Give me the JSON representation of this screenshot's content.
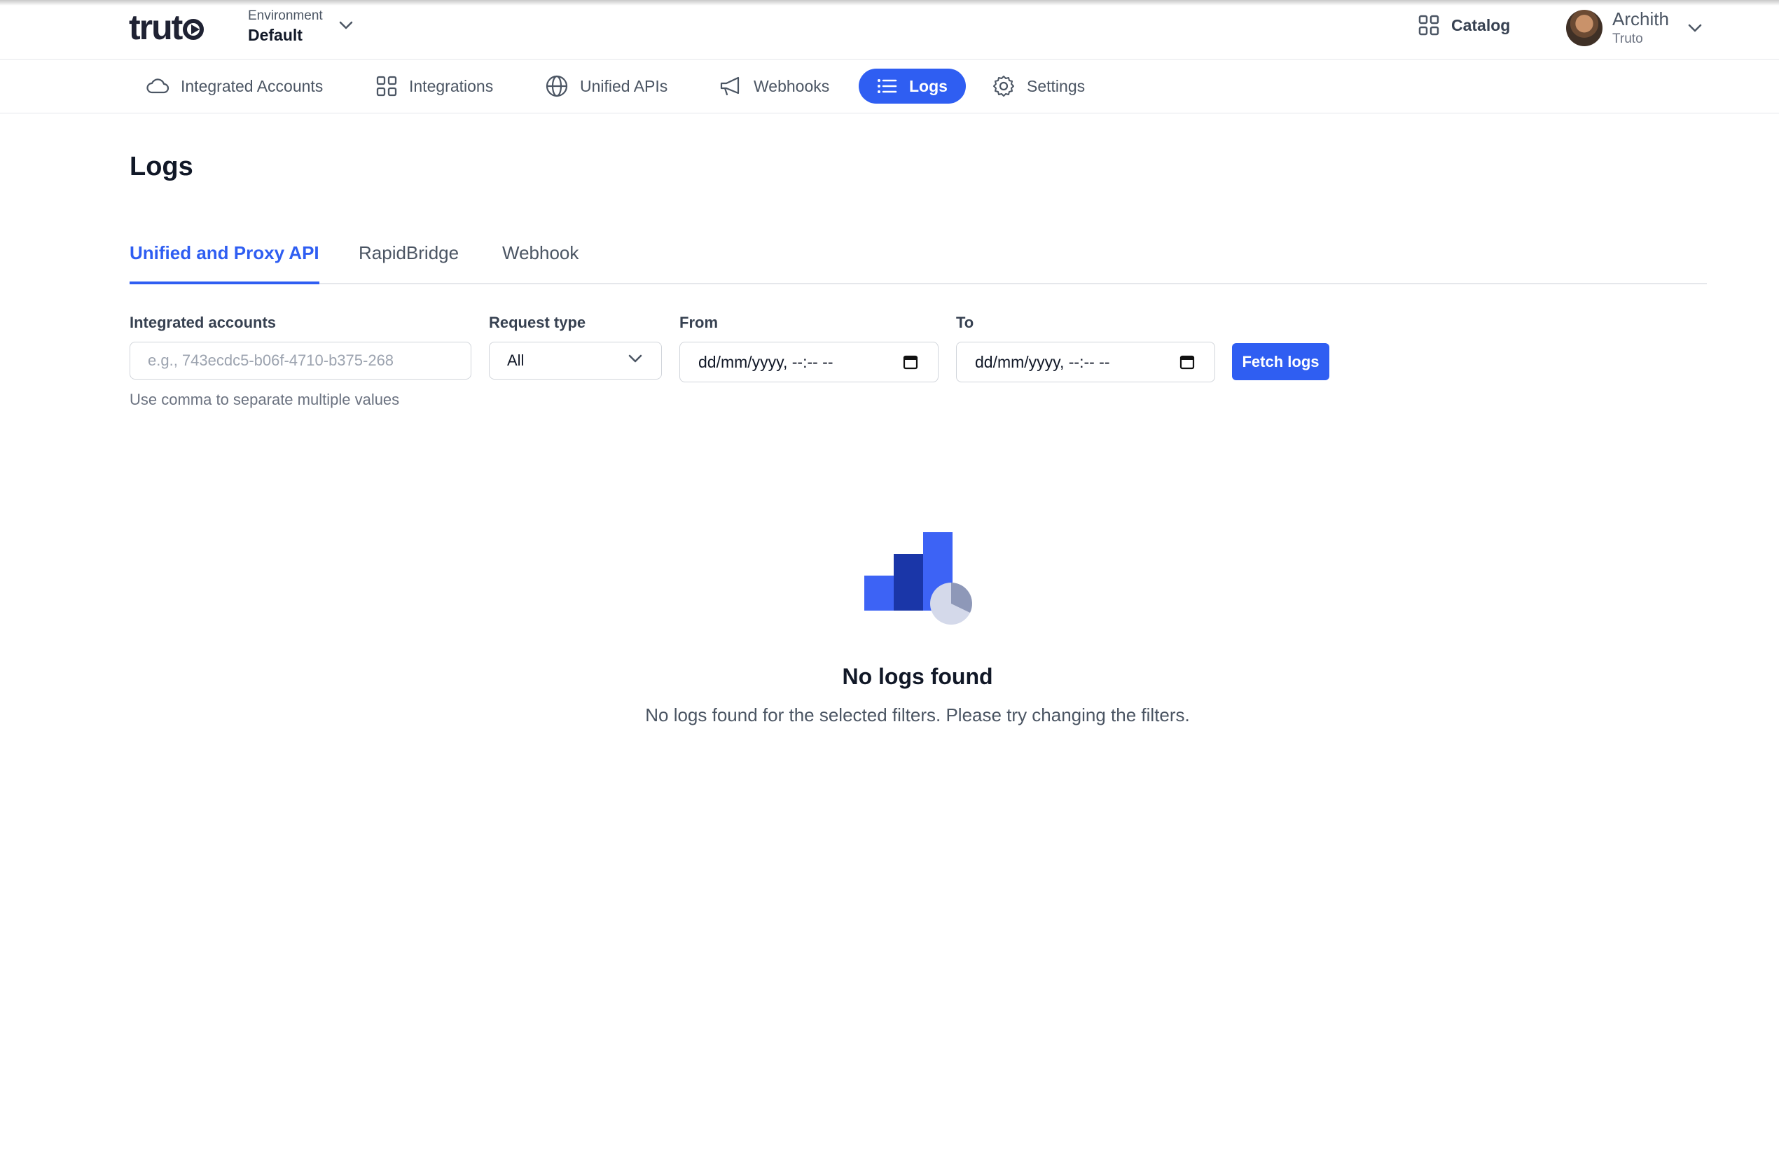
{
  "app": {
    "logo_text": "trut",
    "environment_label": "Environment",
    "environment_value": "Default"
  },
  "header": {
    "catalog_label": "Catalog",
    "catalog_icon": "grid-icon",
    "user_name": "Archith",
    "user_org": "Truto"
  },
  "nav": {
    "items": [
      {
        "label": "Integrated Accounts",
        "icon": "cloud-icon"
      },
      {
        "label": "Integrations",
        "icon": "grid-icon"
      },
      {
        "label": "Unified APIs",
        "icon": "globe-icon"
      },
      {
        "label": "Webhooks",
        "icon": "megaphone-icon"
      },
      {
        "label": "Logs",
        "icon": "list-icon",
        "active": true
      },
      {
        "label": "Settings",
        "icon": "gear-icon"
      }
    ]
  },
  "page": {
    "title": "Logs",
    "tabs": [
      {
        "label": "Unified and Proxy API",
        "active": true
      },
      {
        "label": "RapidBridge"
      },
      {
        "label": "Webhook"
      }
    ]
  },
  "filters": {
    "accounts_label": "Integrated accounts",
    "accounts_placeholder": "e.g., 743ecdc5-b06f-4710-b375-268",
    "accounts_hint": "Use comma to separate multiple values",
    "request_type_label": "Request type",
    "request_type_value": "All",
    "from_label": "From",
    "from_value": "dd/mm/yyyy, --:-- --",
    "to_label": "To",
    "to_value": "dd/mm/yyyy, --:-- --",
    "fetch_button": "Fetch logs"
  },
  "empty_state": {
    "title": "No logs found",
    "description": "No logs found for the selected filters. Please try changing the filters."
  },
  "colors": {
    "accent": "#2f5ef2",
    "text_dark": "#111827",
    "text_muted": "#4b5563",
    "border": "#e5e7eb"
  }
}
